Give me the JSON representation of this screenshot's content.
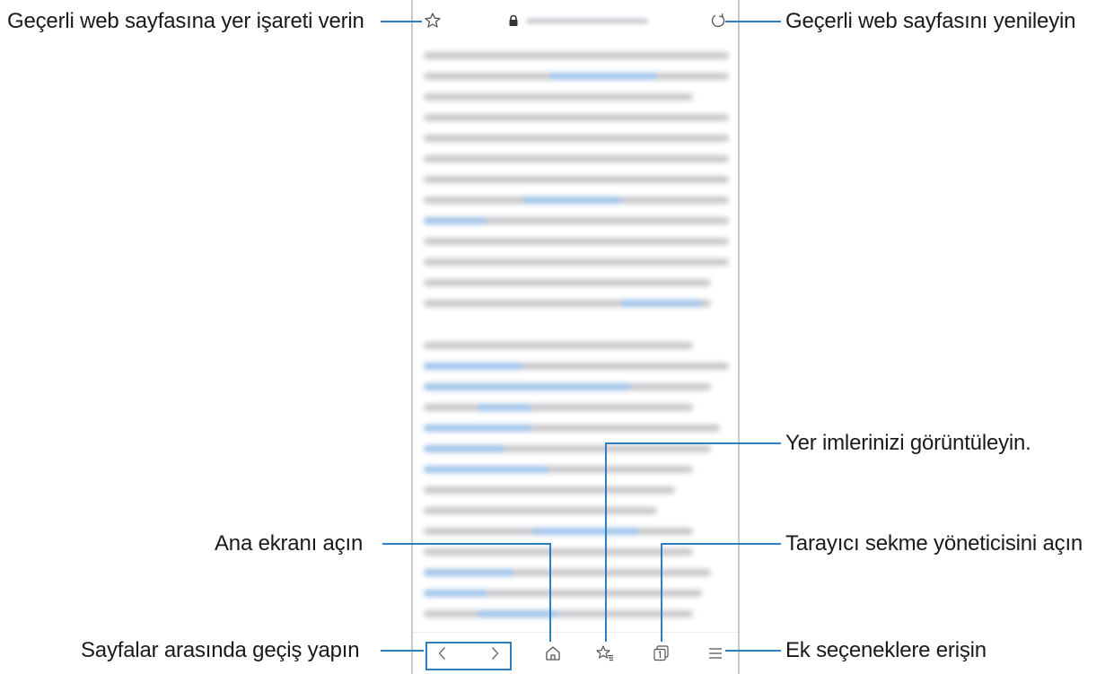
{
  "callouts": {
    "bookmark_page": "Geçerli web sayfasına yer işareti verin",
    "refresh_page": "Geçerli web sayfasını yenileyin",
    "view_bookmarks": "Yer imlerinizi görüntüleyin.",
    "open_home": "Ana ekranı açın",
    "tab_manager": "Tarayıcı sekme yöneticisini açın",
    "navigate_pages": "Sayfalar arasında geçiş yapın",
    "more_options": "Ek seçeneklere erişin"
  },
  "browser": {
    "top_icons": [
      "star-icon",
      "lock-icon",
      "refresh-icon"
    ],
    "bottom_icons": [
      "back-arrow-icon",
      "forward-arrow-icon",
      "home-icon",
      "bookmarks-icon",
      "tabs-icon",
      "menu-icon"
    ]
  },
  "colors": {
    "accent": "#2d7fc1",
    "icon": "#555555",
    "blurred_text": "#c8c8cc",
    "blurred_link": "#9ec2e8"
  }
}
